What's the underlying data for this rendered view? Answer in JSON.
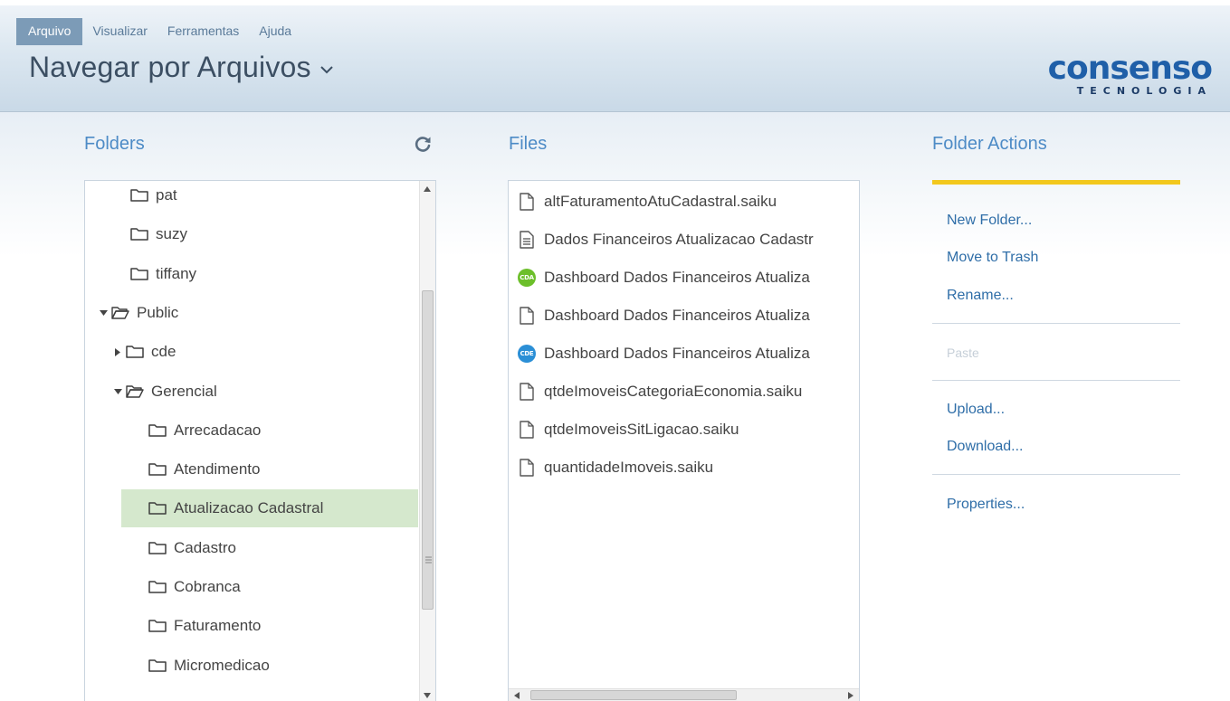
{
  "menu": {
    "items": [
      {
        "label": "Arquivo",
        "active": true
      },
      {
        "label": "Visualizar",
        "active": false
      },
      {
        "label": "Ferramentas",
        "active": false
      },
      {
        "label": "Ajuda",
        "active": false
      }
    ]
  },
  "page_title": "Navegar por Arquivos",
  "logo": {
    "top": "consenso",
    "bottom": "TECNOLOGIA"
  },
  "folders": {
    "title": "Folders",
    "rows": [
      {
        "label": "pat",
        "arrow": "none",
        "open": false,
        "selected": false
      },
      {
        "label": "suzy",
        "arrow": "none",
        "open": false,
        "selected": false
      },
      {
        "label": "tiffany",
        "arrow": "none",
        "open": false,
        "selected": false
      },
      {
        "label": "Public",
        "arrow": "expanded",
        "open": true,
        "selected": false
      },
      {
        "label": "cde",
        "arrow": "collapsed",
        "open": false,
        "selected": false
      },
      {
        "label": "Gerencial",
        "arrow": "expanded",
        "open": true,
        "selected": false
      },
      {
        "label": "Arrecadacao",
        "arrow": "none",
        "open": false,
        "selected": false
      },
      {
        "label": "Atendimento",
        "arrow": "none",
        "open": false,
        "selected": false
      },
      {
        "label": "Atualizacao Cadastral",
        "arrow": "none",
        "open": false,
        "selected": true
      },
      {
        "label": "Cadastro",
        "arrow": "none",
        "open": false,
        "selected": false
      },
      {
        "label": "Cobranca",
        "arrow": "none",
        "open": false,
        "selected": false
      },
      {
        "label": "Faturamento",
        "arrow": "none",
        "open": false,
        "selected": false
      },
      {
        "label": "Micromedicao",
        "arrow": "none",
        "open": false,
        "selected": false
      }
    ]
  },
  "files": {
    "title": "Files",
    "items": [
      {
        "label": "altFaturamentoAtuCadastral.saiku",
        "icon": "file-icon"
      },
      {
        "label": "Dados Financeiros Atualizacao Cadastr",
        "icon": "document-icon"
      },
      {
        "label": "Dashboard Dados Financeiros Atualiza",
        "icon": "cda-icon",
        "badge": "CDA",
        "badge_color": "#6cbf2a"
      },
      {
        "label": "Dashboard Dados Financeiros Atualiza",
        "icon": "file-icon"
      },
      {
        "label": "Dashboard Dados Financeiros Atualiza",
        "icon": "cde-icon",
        "badge": "CDE",
        "badge_color": "#2b8fd6"
      },
      {
        "label": "qtdeImoveisCategoriaEconomia.saiku",
        "icon": "file-icon"
      },
      {
        "label": "qtdeImoveisSitLigacao.saiku",
        "icon": "file-icon"
      },
      {
        "label": "quantidadeImoveis.saiku",
        "icon": "file-icon"
      }
    ]
  },
  "actions": {
    "title": "Folder Actions",
    "new_folder": "New Folder...",
    "move_to_trash": "Move to Trash",
    "rename": "Rename...",
    "paste": "Paste",
    "upload": "Upload...",
    "download": "Download...",
    "properties": "Properties..."
  },
  "colors": {
    "accent": "#4d8bc6",
    "selected_row": "#d5e8cd",
    "actions_underline": "#f2c81d",
    "link": "#2f6ea8"
  }
}
